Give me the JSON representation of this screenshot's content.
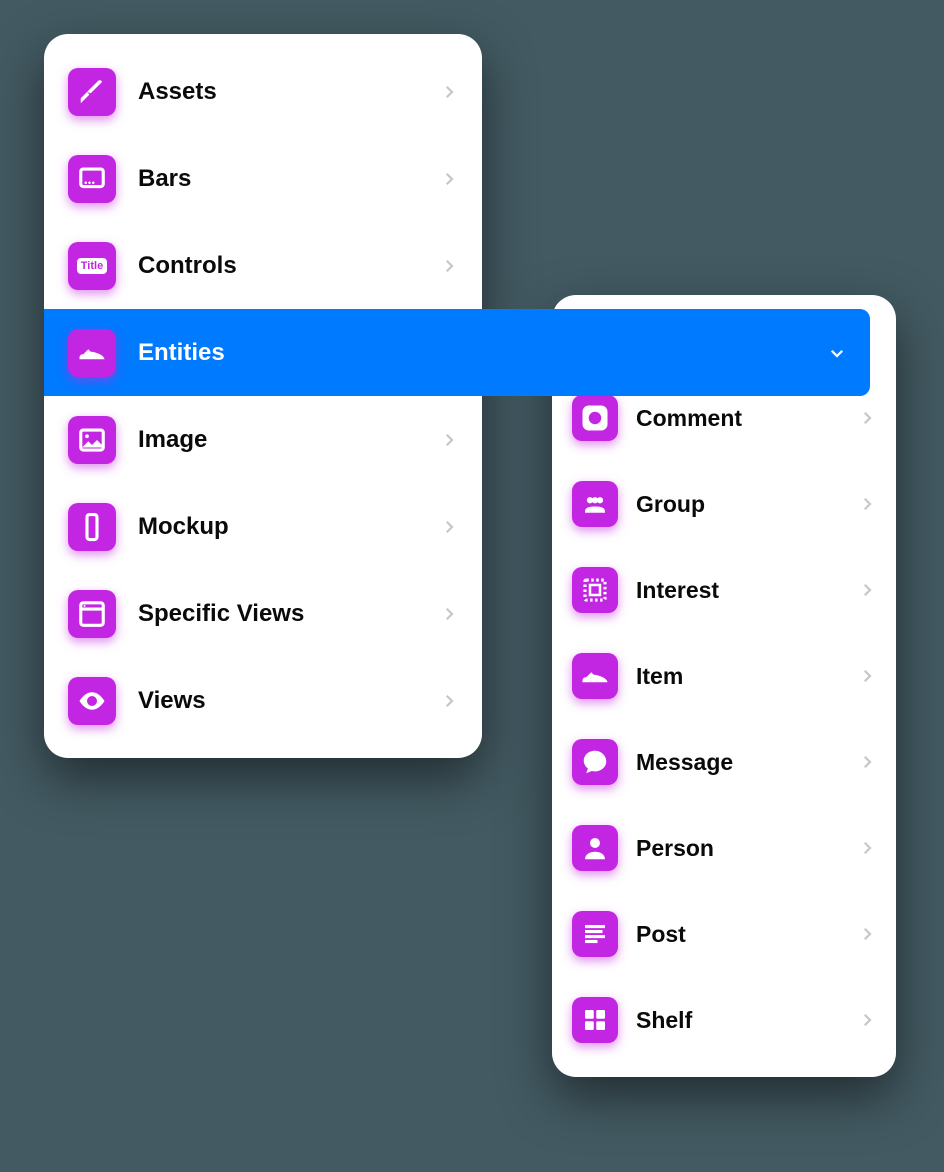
{
  "colors": {
    "accent": "#c326e3",
    "selected": "#007aff",
    "background": "#435a62"
  },
  "leftPanel": {
    "items": [
      {
        "label": "Assets",
        "icon": "knife-icon",
        "selected": false
      },
      {
        "label": "Bars",
        "icon": "monitor-icon",
        "selected": false
      },
      {
        "label": "Controls",
        "icon": "title-icon",
        "selected": false
      },
      {
        "label": "Entities",
        "icon": "shoe-icon",
        "selected": true
      },
      {
        "label": "Image",
        "icon": "image-icon",
        "selected": false
      },
      {
        "label": "Mockup",
        "icon": "phone-icon",
        "selected": false
      },
      {
        "label": "Specific Views",
        "icon": "window-icon",
        "selected": false
      },
      {
        "label": "Views",
        "icon": "eye-icon",
        "selected": false
      }
    ]
  },
  "rightPanel": {
    "items": [
      {
        "label": "Comment",
        "icon": "comment-icon"
      },
      {
        "label": "Group",
        "icon": "group-icon"
      },
      {
        "label": "Interest",
        "icon": "stamp-icon"
      },
      {
        "label": "Item",
        "icon": "shoe-icon"
      },
      {
        "label": "Message",
        "icon": "message-icon"
      },
      {
        "label": "Person",
        "icon": "person-icon"
      },
      {
        "label": "Post",
        "icon": "post-icon"
      },
      {
        "label": "Shelf",
        "icon": "shelf-icon"
      }
    ]
  }
}
